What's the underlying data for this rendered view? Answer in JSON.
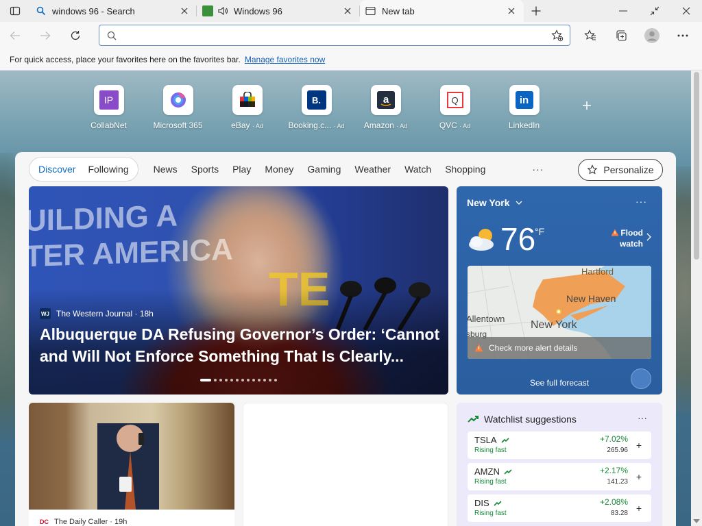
{
  "tabs": [
    {
      "title": "windows 96 - Search",
      "icon": "bing-search-icon"
    },
    {
      "title": "Windows 96",
      "icon": "audio-speaker-icon"
    },
    {
      "title": "New tab",
      "icon": "new-tab-icon"
    }
  ],
  "address": {
    "value": "",
    "placeholder": ""
  },
  "favbar": {
    "text": "For quick access, place your favorites here on the favorites bar.",
    "link": "Manage favorites now"
  },
  "quicklinks": [
    {
      "label": "CollabNet",
      "ad": "",
      "tile_text": "IP"
    },
    {
      "label": "Microsoft 365",
      "ad": ""
    },
    {
      "label": "eBay",
      "ad": "· Ad"
    },
    {
      "label": "Booking.c...",
      "ad": "· Ad",
      "tile_text": "B."
    },
    {
      "label": "Amazon",
      "ad": "· Ad"
    },
    {
      "label": "QVC",
      "ad": "· Ad",
      "tile_text": "Q"
    },
    {
      "label": "LinkedIn",
      "ad": "",
      "tile_text": "in"
    }
  ],
  "nav": {
    "pill": [
      "Discover",
      "Following"
    ],
    "items": [
      "News",
      "Sports",
      "Play",
      "Money",
      "Gaming",
      "Weather",
      "Watch",
      "Shopping"
    ],
    "more": "···",
    "personalize": "Personalize"
  },
  "hero": {
    "bg_text": "UILDING A\nTER AMERICA",
    "bg_text2": "TE",
    "source_logo": "WJ",
    "source": "The Western Journal · 18h",
    "headline": "Albuquerque DA Refusing Governor’s Order: ‘Cannot and Will Not Enforce Something That Is Clearly..."
  },
  "weather": {
    "city": "New York",
    "temp": "76",
    "unit": "°F",
    "alert_line1": "Flood",
    "alert_line2": "watch",
    "map_labels": [
      "Hartford",
      "New Haven",
      "Allentown",
      "New York",
      "sburg"
    ],
    "alert_bar": "Check more alert details",
    "forecast": "See full forecast",
    "more": "···"
  },
  "card2": {
    "source_logo": "DC",
    "source": "The Daily Caller · 19h"
  },
  "watchlist": {
    "title": "Watchlist suggestions",
    "more": "···",
    "stocks": [
      {
        "symbol": "TSLA",
        "status": "Rising fast",
        "change": "+7.02%",
        "price": "265.96"
      },
      {
        "symbol": "AMZN",
        "status": "Rising fast",
        "change": "+2.17%",
        "price": "141.23"
      },
      {
        "symbol": "DIS",
        "status": "Rising fast",
        "change": "+2.08%",
        "price": "83.28"
      }
    ]
  },
  "colors": {
    "accent": "#0f6cbd",
    "rising": "#138a36",
    "weather_bg": "#2f67ad"
  }
}
